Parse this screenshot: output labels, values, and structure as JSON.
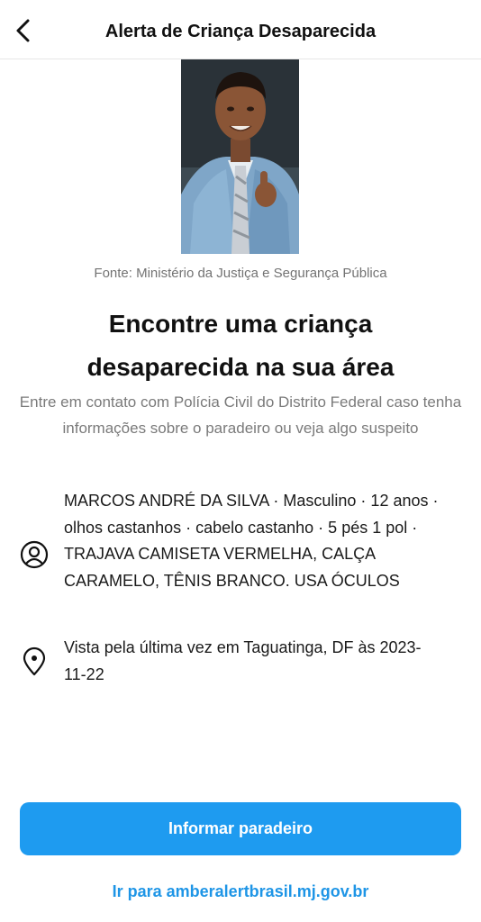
{
  "header": {
    "title": "Alerta de Criança Desaparecida"
  },
  "photo": {
    "source": "Fonte: Ministério da Justiça e Segurança Pública"
  },
  "main": {
    "headline_line1": "Encontre uma criança",
    "headline_line2": "desaparecida na sua área",
    "subtext": "Entre em contato com Polícia Civil do Distrito Federal caso tenha informações sobre o paradeiro ou veja algo suspeito"
  },
  "details": {
    "description": "MARCOS ANDRÉ DA SILVA · Masculino · 12 anos · olhos castanhos · cabelo castanho · 5 pés 1 pol · TRAJAVA CAMISETA VERMELHA, CALÇA CARAMELO, TÊNIS BRANCO. USA ÓCULOS",
    "last_seen": "Vista pela última vez em Taguatinga, DF às 2023-11-22"
  },
  "actions": {
    "report_label": "Informar paradeiro",
    "link_label": "Ir para amberalertbrasil.mj.gov.br"
  },
  "colors": {
    "accent": "#1e9bf0",
    "link": "#1e95e6"
  },
  "icons": {
    "back": "chevron-left-icon",
    "person": "person-icon",
    "location": "location-pin-icon"
  }
}
